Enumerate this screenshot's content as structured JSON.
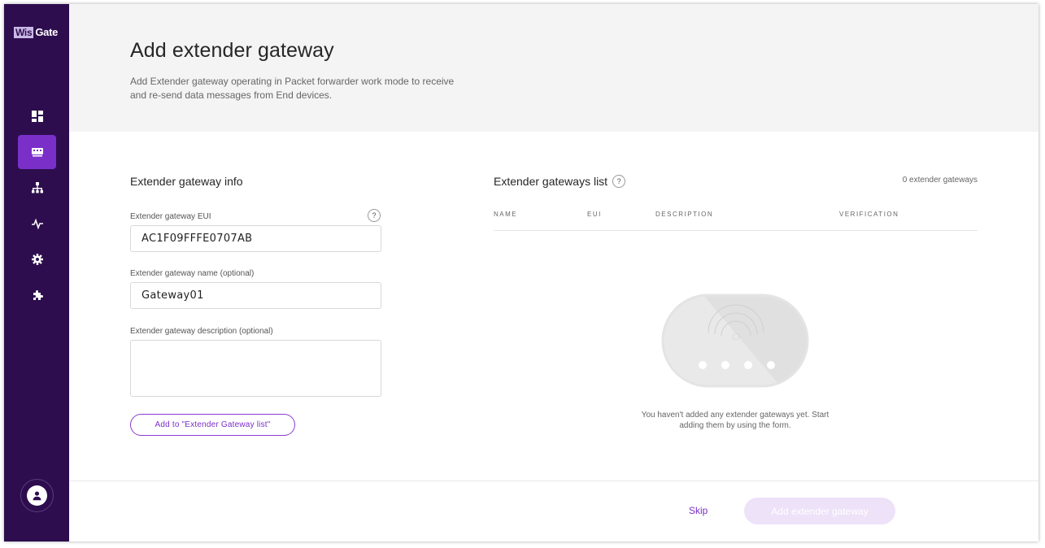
{
  "app": {
    "logo_wis": "Wis",
    "logo_gate": "Gate"
  },
  "sidebar": {
    "items": [
      {
        "icon": "dashboard-icon",
        "active": false
      },
      {
        "icon": "gateway-icon",
        "active": true
      },
      {
        "icon": "network-icon",
        "active": false
      },
      {
        "icon": "activity-icon",
        "active": false
      },
      {
        "icon": "settings-icon",
        "active": false
      },
      {
        "icon": "extensions-icon",
        "active": false
      }
    ],
    "avatar_icon": "user-icon"
  },
  "header": {
    "title": "Add extender gateway",
    "subtitle": "Add Extender gateway operating in Packet forwarder work mode to receive and re-send data messages from End devices."
  },
  "form": {
    "title": "Extender gateway info",
    "eui_label": "Extender gateway EUI",
    "eui_value": "AC1F09FFFE0707AB",
    "eui_help": "?",
    "name_label": "Extender gateway name (optional)",
    "name_value": "Gateway01",
    "description_label": "Extender gateway description (optional)",
    "description_value": "",
    "add_button": "Add to \"Extender Gateway list\""
  },
  "list": {
    "title": "Extender gateways list",
    "help": "?",
    "count": "0 extender gateways",
    "columns": [
      "NAME",
      "EUI",
      "DESCRIPTION",
      "VERIFICATION"
    ],
    "empty_message": "You haven't added any extender gateways yet. Start adding them by using the form."
  },
  "footer": {
    "skip": "Skip",
    "submit": "Add extender gateway"
  },
  "colors": {
    "sidebar": "#2d0d4e",
    "accent": "#7b2fc9",
    "primary_disabled": "#ede2f8"
  }
}
